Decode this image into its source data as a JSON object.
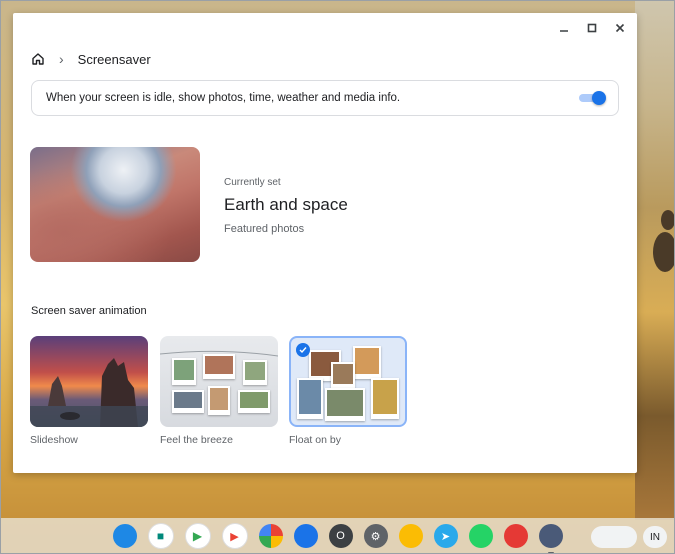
{
  "window": {
    "breadcrumb_title": "Screensaver",
    "controls": [
      "minimize-icon",
      "maximize-icon",
      "close-icon"
    ]
  },
  "toggle": {
    "text": "When your screen is idle, show photos, time, weather and media info.",
    "state": "on",
    "accent_color": "#1a73e8"
  },
  "current": {
    "label": "Currently set",
    "title": "Earth and space",
    "subtitle": "Featured photos"
  },
  "animation": {
    "section_title": "Screen saver animation",
    "options": [
      {
        "label": "Slideshow",
        "selected": false
      },
      {
        "label": "Feel the breeze",
        "selected": false
      },
      {
        "label": "Float on by",
        "selected": true
      }
    ]
  },
  "shelf": {
    "apps": [
      "files-icon",
      "meet-icon",
      "play-store-icon",
      "youtube-icon",
      "photos-icon",
      "messages-icon",
      "o-app-icon",
      "settings-icon",
      "keep-icon",
      "telegram-icon",
      "whatsapp-icon",
      "palette-icon",
      "screen-capture-icon"
    ],
    "status_text": "IN"
  }
}
